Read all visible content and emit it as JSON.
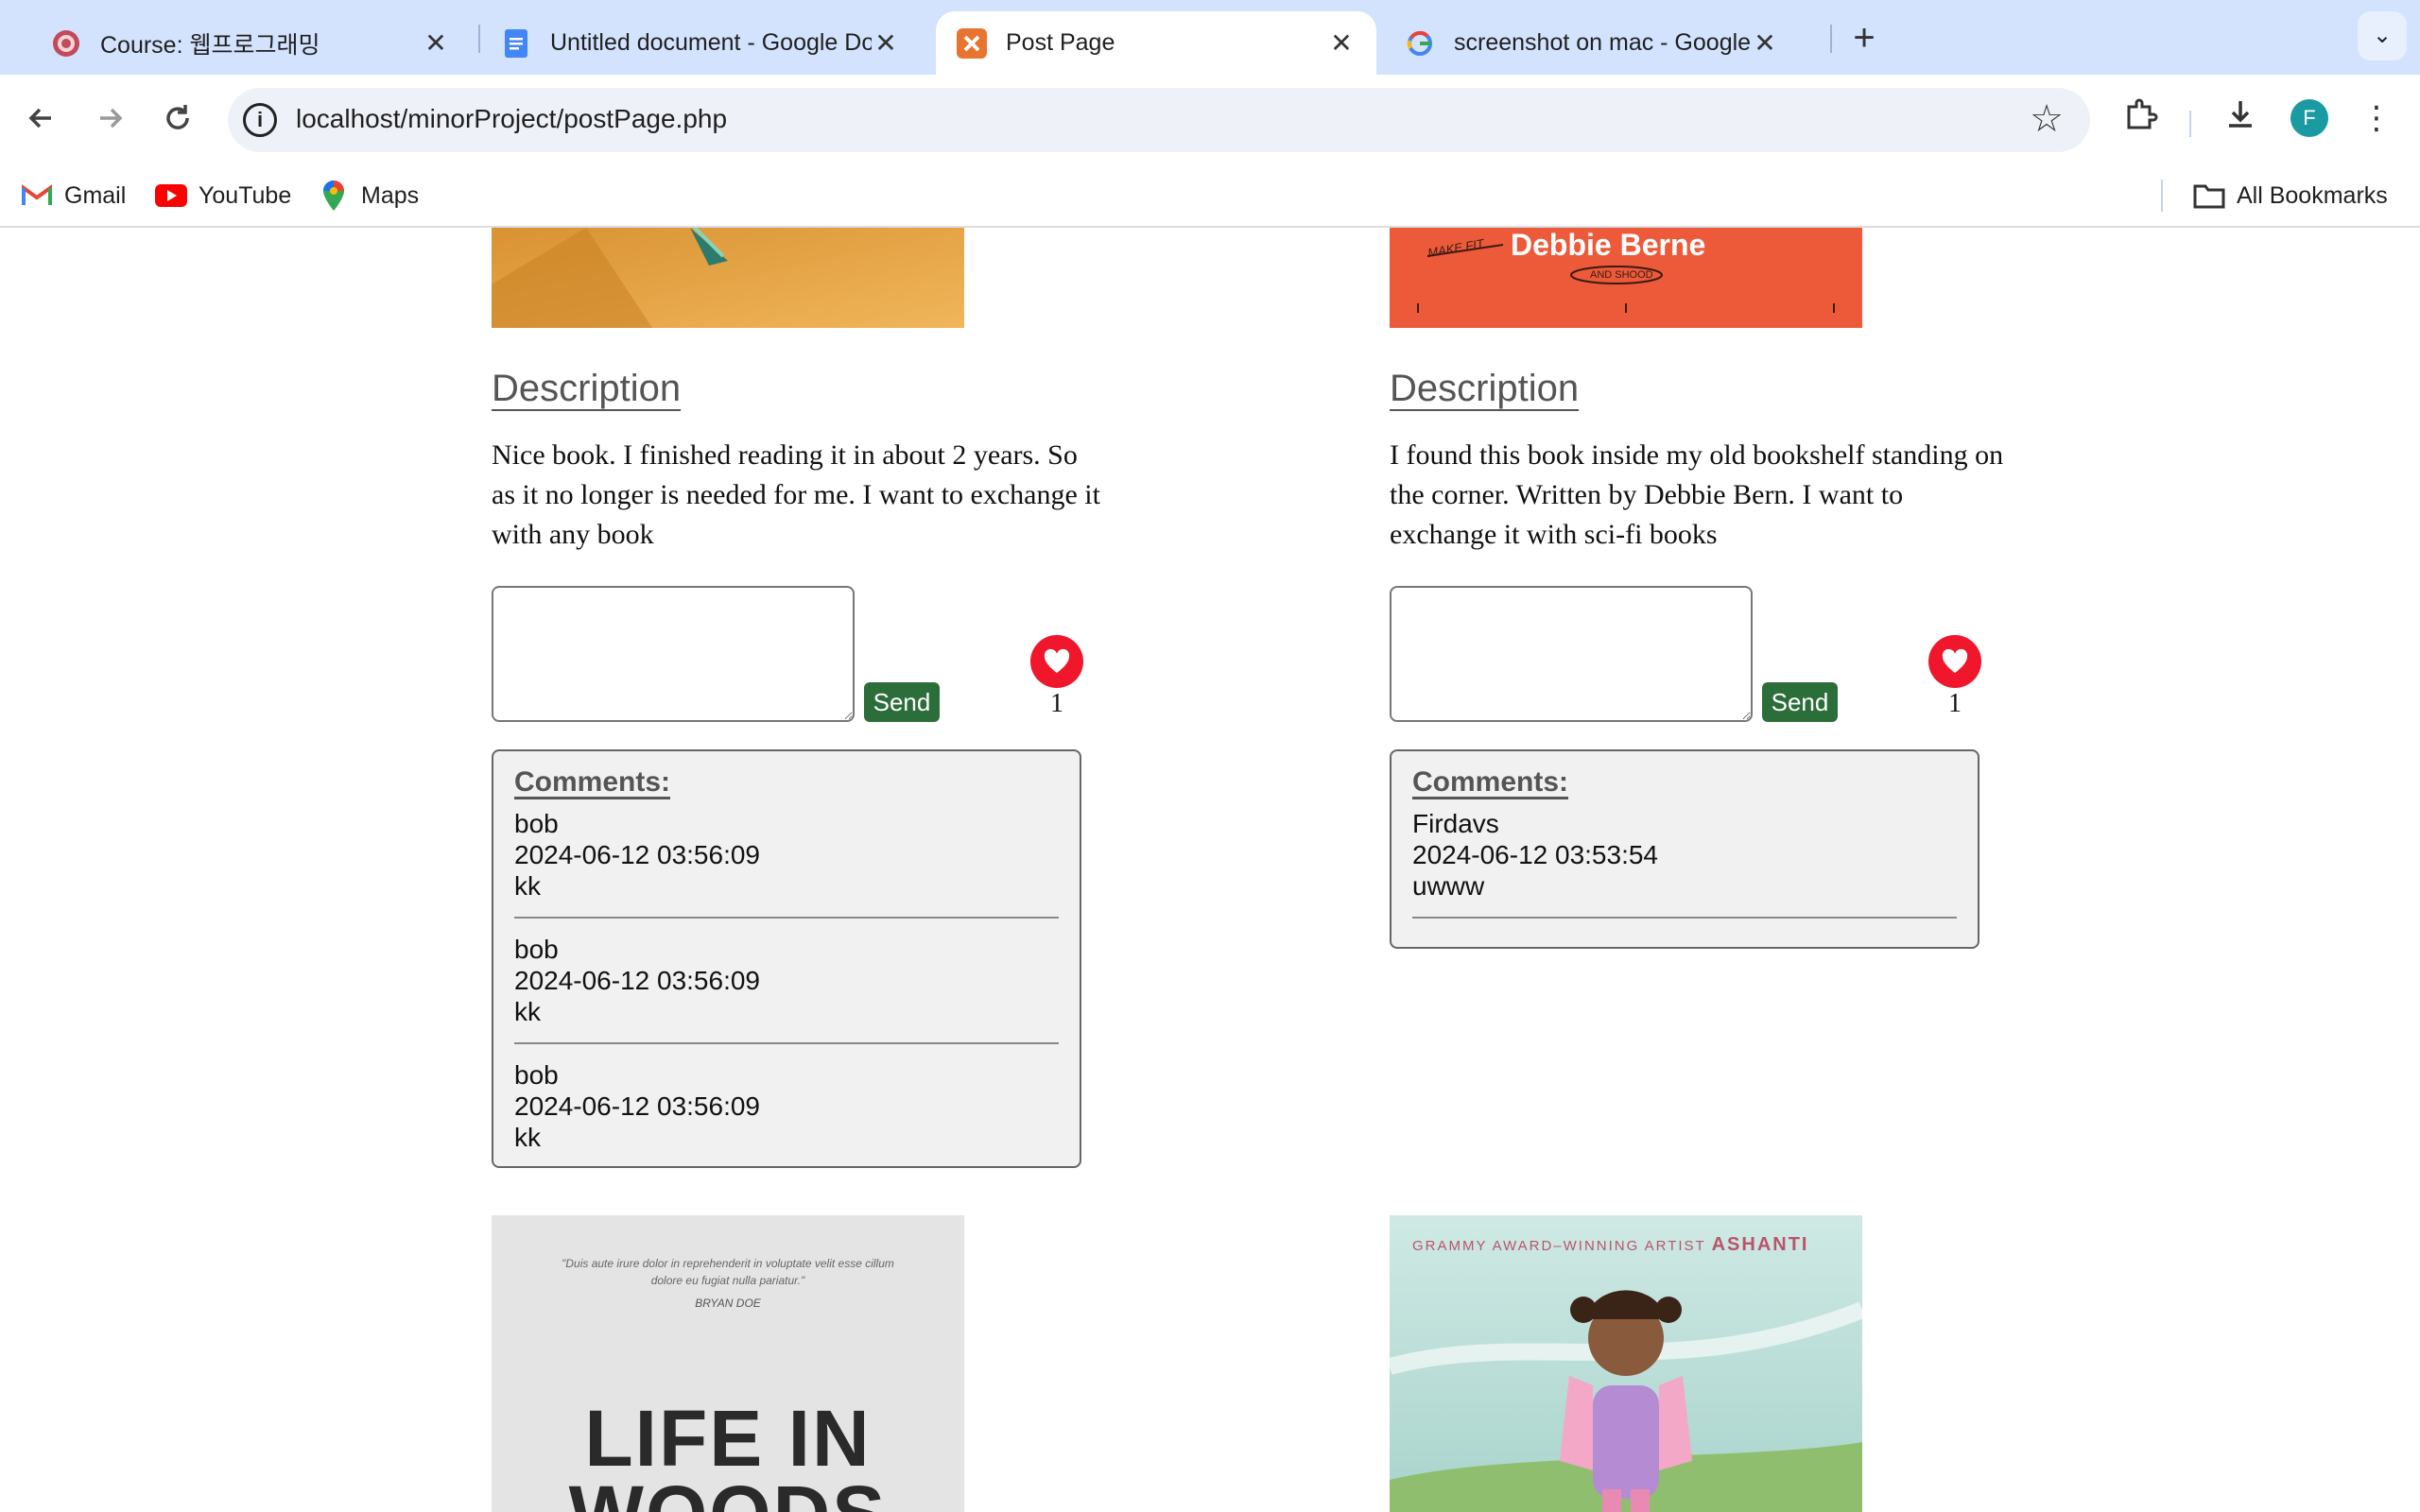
{
  "browser": {
    "tabs": [
      {
        "title": "Course: 웹프로그래밍",
        "favicon": "university-crest-icon",
        "active": false
      },
      {
        "title": "Untitled document - Google Docs",
        "favicon": "google-docs-icon",
        "active": false
      },
      {
        "title": "Post Page",
        "favicon": "xampp-icon",
        "active": true
      },
      {
        "title": "screenshot on mac - Google Search",
        "favicon": "google-icon",
        "active": false
      }
    ],
    "address": "localhost/minorProject/postPage.php",
    "profile_initial": "F",
    "bookmarks": [
      {
        "label": "Gmail",
        "icon": "gmail-icon"
      },
      {
        "label": "YouTube",
        "icon": "youtube-icon"
      },
      {
        "label": "Maps",
        "icon": "maps-icon"
      }
    ],
    "all_bookmarks": "All Bookmarks"
  },
  "posts": [
    {
      "description_heading": "Description",
      "description": "Nice book. I finished reading it in about 2 years. So as it no longer is needed for me. I want to exchange it with any book",
      "send_label": "Send",
      "likes": "1",
      "comments_title": "Comments:",
      "comments": [
        {
          "user": "bob",
          "time": "2024-06-12 03:56:09",
          "text": "kk"
        },
        {
          "user": "bob",
          "time": "2024-06-12 03:56:09",
          "text": "kk"
        },
        {
          "user": "bob",
          "time": "2024-06-12 03:56:09",
          "text": "kk"
        }
      ]
    },
    {
      "cover_text": {
        "author": "Debbie Berne",
        "tag": "MAKE FIT",
        "small": "AND SHOOD"
      },
      "description_heading": "Description",
      "description": "I found this book inside my old bookshelf standing on the corner. Written by Debbie Bern. I want to exchange it with sci-fi books",
      "send_label": "Send",
      "likes": "1",
      "comments_title": "Comments:",
      "comments": [
        {
          "user": "Firdavs",
          "time": "2024-06-12 03:53:54",
          "text": "uwww"
        }
      ]
    }
  ],
  "next_covers": [
    {
      "quote": "\"Duis aute irure dolor in reprehenderit in voluptate velit esse cillum dolore eu fugiat nulla pariatur.\"",
      "attribution": "BRYAN DOE",
      "title": "LIFE IN WOODS"
    },
    {
      "banner_prefix": "GRAMMY AWARD–WINNING ARTIST",
      "banner_name": "ASHANTI"
    }
  ]
}
